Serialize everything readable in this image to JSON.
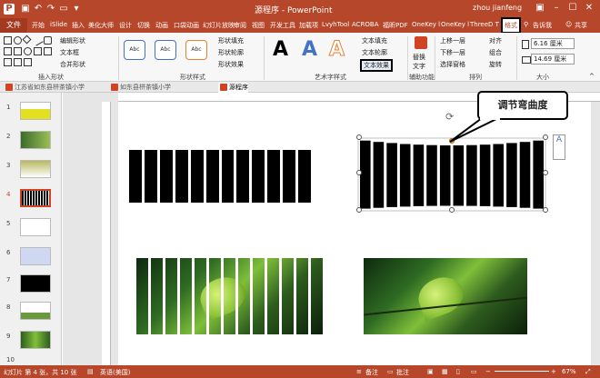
{
  "titlebar": {
    "title": "源程序 - PowerPoint",
    "user": "zhou jianfeng",
    "qat_icons": [
      "save-icon",
      "undo-icon",
      "redo-icon",
      "slideshow-icon"
    ]
  },
  "tabs": {
    "file": "文件",
    "items": [
      "开始",
      "iSlide",
      "插入",
      "美化大师",
      "设计",
      "切换",
      "动画",
      "口袋动画",
      "幻灯片放映",
      "审阅",
      "视图",
      "开发工具",
      "加载项",
      "LvyhTool",
      "ACROBA",
      "福昕PDF",
      "OneKey l",
      "OneKey l",
      "ThreeD T",
      "格式"
    ],
    "search_placeholder": "告诉我",
    "share": "共享"
  },
  "ribbon": {
    "insert_shapes": {
      "label": "插入形状",
      "edit_shape": "编辑形状",
      "textbox": "文本框",
      "merge": "合并形状"
    },
    "shape_styles": {
      "label": "形状样式",
      "fill": "形状填充",
      "outline": "形状轮廓",
      "effect": "形状效果",
      "samples": [
        "Abc",
        "Abc",
        "Abc"
      ]
    },
    "wordart": {
      "label": "艺术字样式",
      "text_fill": "文本填充",
      "text_outline": "文本轮廓",
      "text_effect": "文本效果",
      "letters": [
        "A",
        "A",
        "A"
      ]
    },
    "accessibility": {
      "label": "辅助功能",
      "alt_text": "替换\n文字"
    },
    "arrange": {
      "label": "排列",
      "bring_forward": "上移一层",
      "send_backward": "下移一层",
      "selection_pane": "选择窗格",
      "align": "对齐",
      "group": "组合",
      "rotate": "旋转"
    },
    "size": {
      "label": "大小",
      "height": "6.16 厘米",
      "width": "14.69 厘米"
    }
  },
  "doc_tabs": [
    "江苏省如东县栟茶镇小学",
    "如东县栟茶镇小学",
    "源程序"
  ],
  "slides": [
    "1",
    "2",
    "3",
    "4",
    "5",
    "6",
    "7",
    "8",
    "9",
    "10"
  ],
  "selected_slide": "4",
  "callout_text": "调节弯曲度",
  "statusbar": {
    "slide_info": "幻灯片 第 4 张，共 10 张",
    "language": "英语(美国)",
    "notes": "备注",
    "comments": "批注",
    "zoom": "67%"
  },
  "colors": {
    "accent": "#b7472a"
  }
}
